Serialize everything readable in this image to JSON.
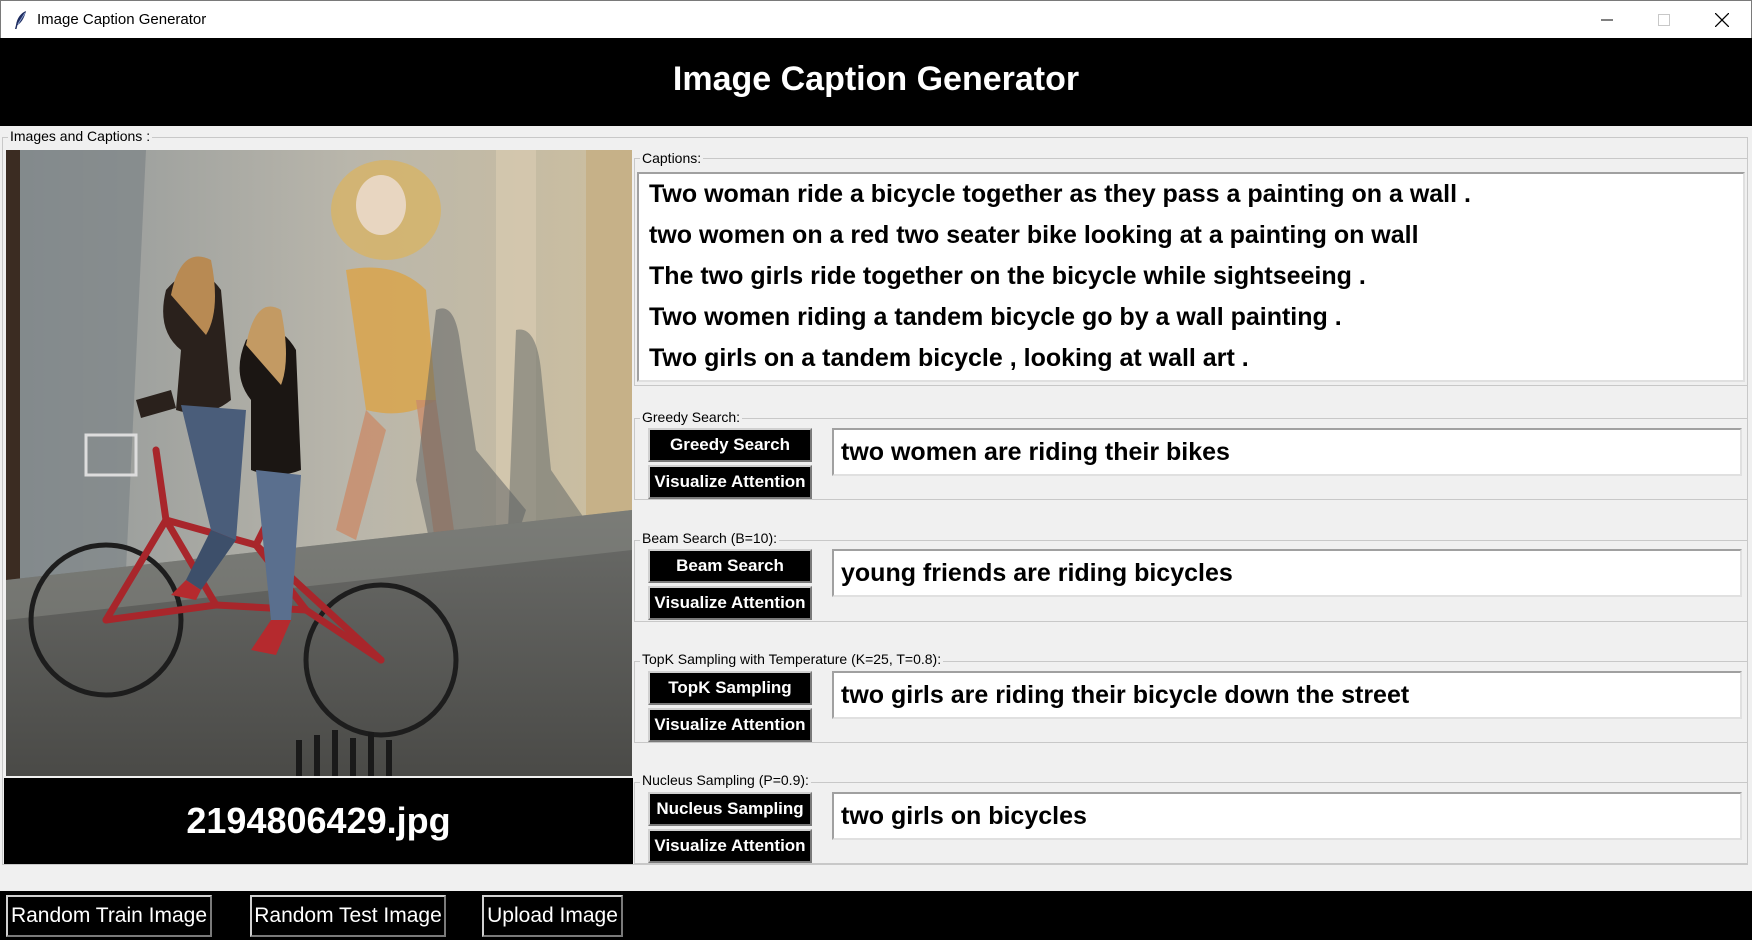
{
  "window": {
    "title": "Image Caption Generator",
    "controls": [
      "minimize-icon",
      "maximize-icon",
      "close-icon"
    ]
  },
  "header": {
    "title": "Image Caption Generator"
  },
  "main_frame": {
    "legend": "Images and Captions :"
  },
  "image": {
    "filename": "2194806429.jpg"
  },
  "captions": {
    "legend": "Captions:",
    "lines": [
      "Two woman ride a bicycle together as they pass a painting on a wall .",
      "two women on a red two seater bike looking at a painting on wall",
      "The two girls ride together on the bicycle while sightseeing .",
      "Two women riding a tandem bicycle go by a wall painting .",
      "Two girls on a tandem bicycle , looking at wall art ."
    ]
  },
  "methods": [
    {
      "legend": "Greedy Search:",
      "button": "Greedy Search",
      "attention": "Visualize Attention",
      "result": "two women are riding their bikes"
    },
    {
      "legend": "Beam Search (B=10):",
      "button": "Beam Search",
      "attention": "Visualize Attention",
      "result": "young friends are riding bicycles"
    },
    {
      "legend": "TopK Sampling with Temperature (K=25, T=0.8):",
      "button": "TopK Sampling",
      "attention": "Visualize Attention",
      "result": "two girls are riding their bicycle down the street"
    },
    {
      "legend": "Nucleus Sampling (P=0.9):",
      "button": "Nucleus Sampling",
      "attention": "Visualize Attention",
      "result": "two girls on bicycles"
    }
  ],
  "bottom_buttons": [
    "Random Train Image",
    "Random Test Image",
    "Upload Image"
  ],
  "colors": {
    "banner": "#000000",
    "window_bg": "#f0f0f0",
    "text_light": "#ffffff"
  }
}
